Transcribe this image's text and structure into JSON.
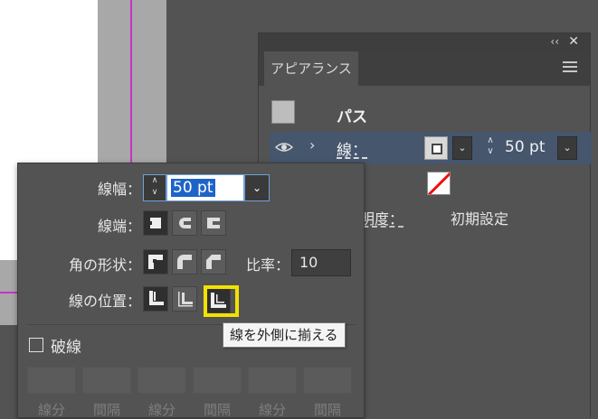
{
  "appearance_panel": {
    "tab_label": "アピアランス",
    "collapse_glyph": "‹‹",
    "close_glyph": "✕",
    "path_label": "パス",
    "stroke_label": "線：",
    "stroke_value": "50 pt",
    "fill_colon": "：",
    "opacity_label": "透明度：",
    "opacity_value": "初期設定",
    "icons": [
      "collapse-icon",
      "close-icon",
      "panel-menu-icon",
      "eye-icon",
      "chevron-right-icon",
      "spin-arrows-icon",
      "chevron-down-icon"
    ]
  },
  "stroke_popup": {
    "weight_label": "線幅：",
    "weight_value": "50 pt",
    "cap_label": "線端：",
    "corner_label": "角の形状：",
    "ratio_label": "比率：",
    "ratio_value": "10",
    "align_label": "線の位置：",
    "dashed_label": "破線",
    "dashed_checked": false,
    "dash_fields": [
      "線分",
      "間隔",
      "線分",
      "間隔",
      "線分",
      "間隔"
    ],
    "icons": [
      "butt-cap-icon",
      "round-cap-icon",
      "projecting-cap-icon",
      "miter-join-icon",
      "round-join-icon",
      "bevel-join-icon",
      "align-center-icon",
      "align-inside-icon",
      "align-outside-icon"
    ]
  },
  "tooltip": {
    "text": "線を外側に揃える"
  },
  "colors": {
    "highlight": "#f2e200",
    "selection_row": "#45566d",
    "guide": "#c832c8",
    "text_selection": "#1e64c8"
  }
}
